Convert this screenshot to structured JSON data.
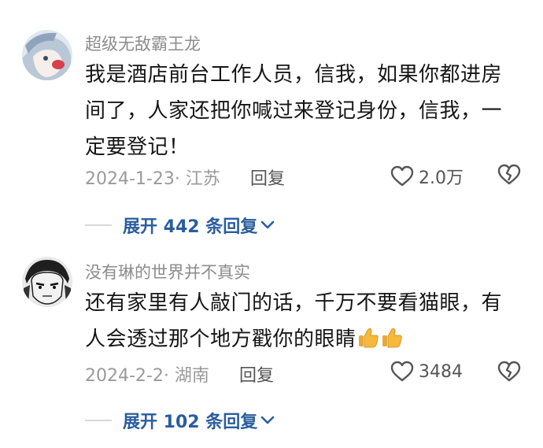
{
  "comments": [
    {
      "username": "超级无敌霸王龙",
      "text": "我是酒店前台工作人员，信我，如果你都进房间了，人家还把你喊过来登记身份，信我，一定要登记！",
      "date_location": "2024-1-23· 江苏",
      "reply_label": "回复",
      "like_count": "2.0万",
      "expand_label": "展开 442 条回复",
      "avatar_icon": "anime-avatar-icon"
    },
    {
      "username": "没有琳的世界并不真实",
      "text": "还有家里有人敲门的话，千万不要看猫眼，有人会透过那个地方戳你的眼睛",
      "emoji": [
        "thumbs-up-icon",
        "thumbs-up-icon"
      ],
      "date_location": "2024-2-2· 湖南",
      "reply_label": "回复",
      "like_count": "3484",
      "expand_label": "展开 102 条回复",
      "avatar_icon": "manga-avatar-icon"
    }
  ],
  "colors": {
    "text": "#161616",
    "meta": "#9a9a9a",
    "link": "#2a5d9f"
  }
}
